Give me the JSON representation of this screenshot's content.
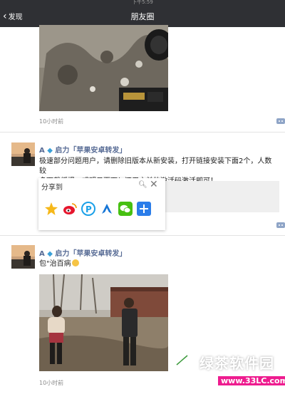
{
  "status_bar": {
    "time": "下午5:59"
  },
  "nav": {
    "back_label": "发现",
    "title": "朋友圈"
  },
  "post1": {
    "time": "10小时前"
  },
  "post2": {
    "user_prefix": "A",
    "user_name": "启力「苹果安卓转发」",
    "text_line1": "极速部分问题用户，请删除旧版本从新安装，打开链接安装下面2个，人数较",
    "text_line2": "多下载缓慢，或明日再下！还用之前的激活码激活即可！"
  },
  "share_panel": {
    "title": "分享到"
  },
  "post3": {
    "user_prefix": "A",
    "user_name": "启力「苹果安卓转发」",
    "text": "包\"治百病",
    "time": "10小时前"
  },
  "watermark": {
    "text": "绿茶软件园",
    "url": "www.33LC.com"
  },
  "colors": {
    "nav_bg": "#2f3034",
    "username": "#576b95",
    "watermark_bar": "#ee1c8f"
  },
  "icons": [
    "qzone-icon",
    "weibo-icon",
    "pay-icon",
    "shield-icon",
    "wechat-icon",
    "plus-icon"
  ]
}
